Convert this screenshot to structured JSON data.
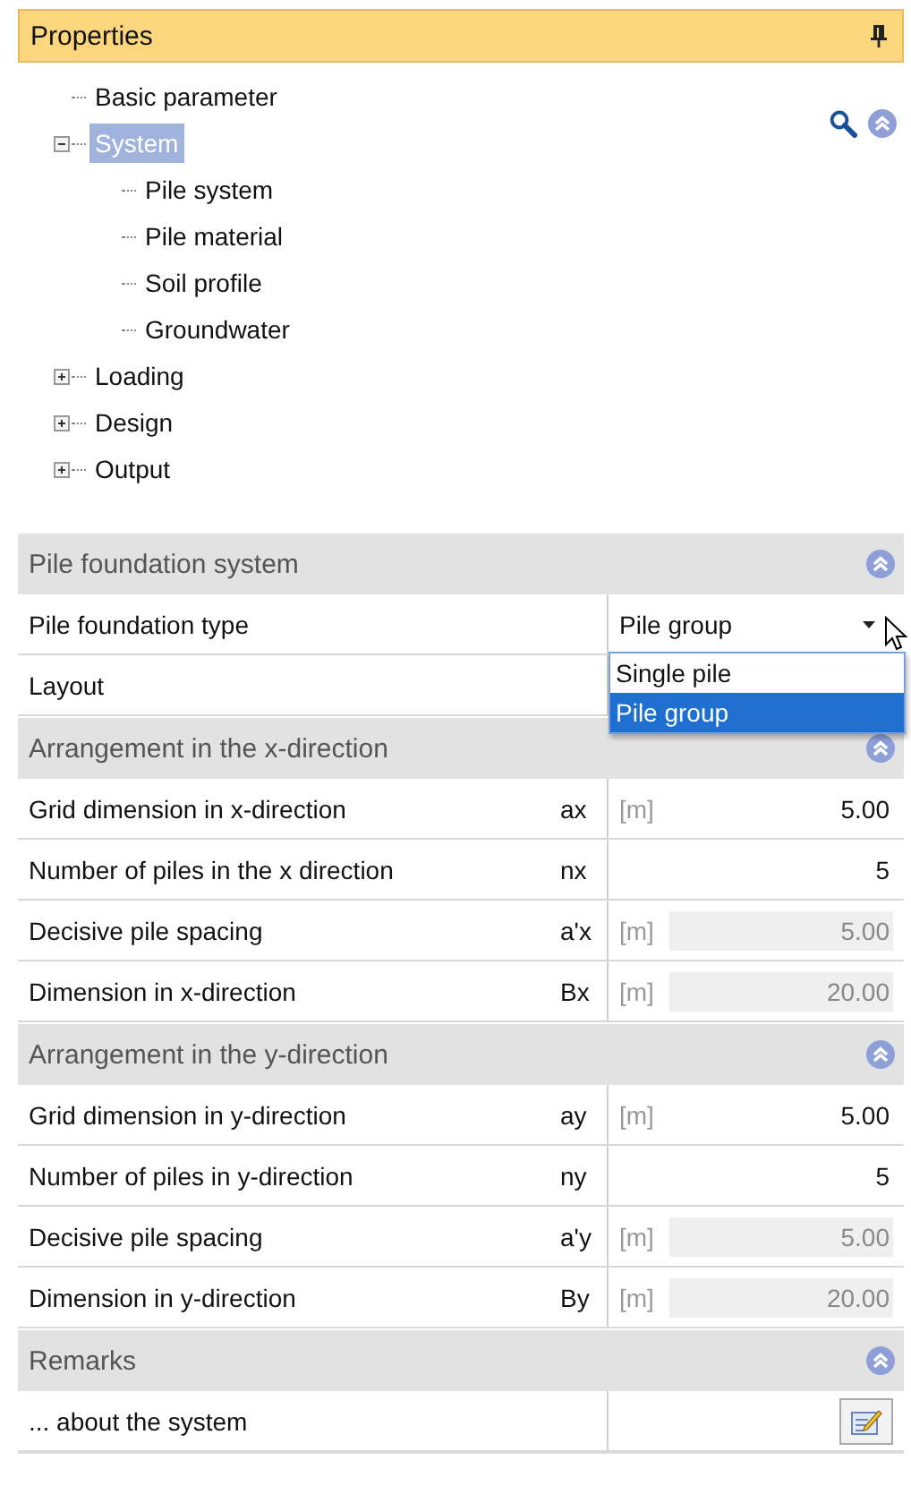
{
  "panel": {
    "title": "Properties"
  },
  "tree": [
    {
      "label": "Basic parameter",
      "selected": false
    },
    {
      "label": "System",
      "expanded": true,
      "selected": true,
      "children": [
        {
          "label": "Pile system",
          "selected": false
        },
        {
          "label": "Pile material",
          "selected": false
        },
        {
          "label": "Soil profile",
          "selected": false
        },
        {
          "label": "Groundwater",
          "selected": false
        }
      ]
    },
    {
      "label": "Loading",
      "expanded": false,
      "selected": false
    },
    {
      "label": "Design",
      "expanded": false,
      "selected": false
    },
    {
      "label": "Output",
      "expanded": false,
      "selected": false
    }
  ],
  "sections": [
    {
      "title": "Pile foundation system",
      "rows": [
        {
          "label": "Pile foundation type",
          "kind": "dropdown",
          "value": "Pile group",
          "open": true,
          "options": [
            {
              "label": "Single pile",
              "selected": false
            },
            {
              "label": "Pile group",
              "selected": true
            }
          ]
        },
        {
          "label": "Layout",
          "kind": "text"
        }
      ]
    },
    {
      "title": "Arrangement in the x-direction",
      "rows": [
        {
          "label": "Grid dimension in x-direction",
          "symbol": "ax",
          "unit": "[m]",
          "value": "5.00",
          "kind": "input"
        },
        {
          "label": "Number of piles in the x direction",
          "symbol": "nx",
          "value": "5",
          "kind": "input"
        },
        {
          "label": "Decisive pile spacing",
          "symbol": "a'x",
          "unit": "[m]",
          "value": "5.00",
          "kind": "readonly"
        },
        {
          "label": "Dimension in x-direction",
          "symbol": "Bx",
          "unit": "[m]",
          "value": "20.00",
          "kind": "readonly"
        }
      ]
    },
    {
      "title": "Arrangement in the y-direction",
      "rows": [
        {
          "label": "Grid dimension in y-direction",
          "symbol": "ay",
          "unit": "[m]",
          "value": "5.00",
          "kind": "input"
        },
        {
          "label": "Number of piles in y-direction",
          "symbol": "ny",
          "value": "5",
          "kind": "input"
        },
        {
          "label": "Decisive pile spacing",
          "symbol": "a'y",
          "unit": "[m]",
          "value": "5.00",
          "kind": "readonly"
        },
        {
          "label": "Dimension in y-direction",
          "symbol": "By",
          "unit": "[m]",
          "value": "20.00",
          "kind": "readonly"
        }
      ]
    },
    {
      "title": "Remarks",
      "rows": [
        {
          "label": "... about the system",
          "kind": "button"
        }
      ]
    }
  ]
}
